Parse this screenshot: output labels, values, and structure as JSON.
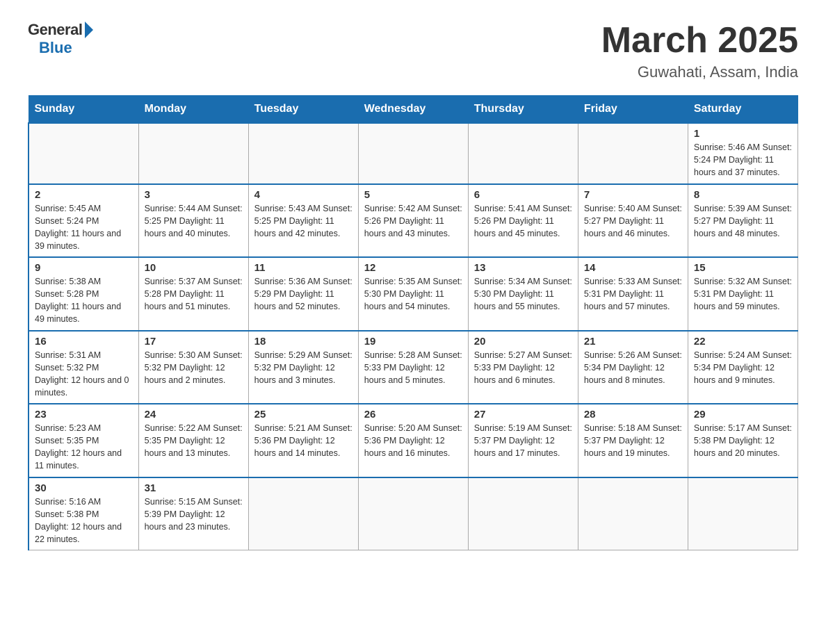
{
  "header": {
    "logo_general": "General",
    "logo_blue": "Blue",
    "title": "March 2025",
    "subtitle": "Guwahati, Assam, India"
  },
  "weekdays": [
    "Sunday",
    "Monday",
    "Tuesday",
    "Wednesday",
    "Thursday",
    "Friday",
    "Saturday"
  ],
  "weeks": [
    [
      {
        "day": "",
        "info": ""
      },
      {
        "day": "",
        "info": ""
      },
      {
        "day": "",
        "info": ""
      },
      {
        "day": "",
        "info": ""
      },
      {
        "day": "",
        "info": ""
      },
      {
        "day": "",
        "info": ""
      },
      {
        "day": "1",
        "info": "Sunrise: 5:46 AM\nSunset: 5:24 PM\nDaylight: 11 hours\nand 37 minutes."
      }
    ],
    [
      {
        "day": "2",
        "info": "Sunrise: 5:45 AM\nSunset: 5:24 PM\nDaylight: 11 hours\nand 39 minutes."
      },
      {
        "day": "3",
        "info": "Sunrise: 5:44 AM\nSunset: 5:25 PM\nDaylight: 11 hours\nand 40 minutes."
      },
      {
        "day": "4",
        "info": "Sunrise: 5:43 AM\nSunset: 5:25 PM\nDaylight: 11 hours\nand 42 minutes."
      },
      {
        "day": "5",
        "info": "Sunrise: 5:42 AM\nSunset: 5:26 PM\nDaylight: 11 hours\nand 43 minutes."
      },
      {
        "day": "6",
        "info": "Sunrise: 5:41 AM\nSunset: 5:26 PM\nDaylight: 11 hours\nand 45 minutes."
      },
      {
        "day": "7",
        "info": "Sunrise: 5:40 AM\nSunset: 5:27 PM\nDaylight: 11 hours\nand 46 minutes."
      },
      {
        "day": "8",
        "info": "Sunrise: 5:39 AM\nSunset: 5:27 PM\nDaylight: 11 hours\nand 48 minutes."
      }
    ],
    [
      {
        "day": "9",
        "info": "Sunrise: 5:38 AM\nSunset: 5:28 PM\nDaylight: 11 hours\nand 49 minutes."
      },
      {
        "day": "10",
        "info": "Sunrise: 5:37 AM\nSunset: 5:28 PM\nDaylight: 11 hours\nand 51 minutes."
      },
      {
        "day": "11",
        "info": "Sunrise: 5:36 AM\nSunset: 5:29 PM\nDaylight: 11 hours\nand 52 minutes."
      },
      {
        "day": "12",
        "info": "Sunrise: 5:35 AM\nSunset: 5:30 PM\nDaylight: 11 hours\nand 54 minutes."
      },
      {
        "day": "13",
        "info": "Sunrise: 5:34 AM\nSunset: 5:30 PM\nDaylight: 11 hours\nand 55 minutes."
      },
      {
        "day": "14",
        "info": "Sunrise: 5:33 AM\nSunset: 5:31 PM\nDaylight: 11 hours\nand 57 minutes."
      },
      {
        "day": "15",
        "info": "Sunrise: 5:32 AM\nSunset: 5:31 PM\nDaylight: 11 hours\nand 59 minutes."
      }
    ],
    [
      {
        "day": "16",
        "info": "Sunrise: 5:31 AM\nSunset: 5:32 PM\nDaylight: 12 hours\nand 0 minutes."
      },
      {
        "day": "17",
        "info": "Sunrise: 5:30 AM\nSunset: 5:32 PM\nDaylight: 12 hours\nand 2 minutes."
      },
      {
        "day": "18",
        "info": "Sunrise: 5:29 AM\nSunset: 5:32 PM\nDaylight: 12 hours\nand 3 minutes."
      },
      {
        "day": "19",
        "info": "Sunrise: 5:28 AM\nSunset: 5:33 PM\nDaylight: 12 hours\nand 5 minutes."
      },
      {
        "day": "20",
        "info": "Sunrise: 5:27 AM\nSunset: 5:33 PM\nDaylight: 12 hours\nand 6 minutes."
      },
      {
        "day": "21",
        "info": "Sunrise: 5:26 AM\nSunset: 5:34 PM\nDaylight: 12 hours\nand 8 minutes."
      },
      {
        "day": "22",
        "info": "Sunrise: 5:24 AM\nSunset: 5:34 PM\nDaylight: 12 hours\nand 9 minutes."
      }
    ],
    [
      {
        "day": "23",
        "info": "Sunrise: 5:23 AM\nSunset: 5:35 PM\nDaylight: 12 hours\nand 11 minutes."
      },
      {
        "day": "24",
        "info": "Sunrise: 5:22 AM\nSunset: 5:35 PM\nDaylight: 12 hours\nand 13 minutes."
      },
      {
        "day": "25",
        "info": "Sunrise: 5:21 AM\nSunset: 5:36 PM\nDaylight: 12 hours\nand 14 minutes."
      },
      {
        "day": "26",
        "info": "Sunrise: 5:20 AM\nSunset: 5:36 PM\nDaylight: 12 hours\nand 16 minutes."
      },
      {
        "day": "27",
        "info": "Sunrise: 5:19 AM\nSunset: 5:37 PM\nDaylight: 12 hours\nand 17 minutes."
      },
      {
        "day": "28",
        "info": "Sunrise: 5:18 AM\nSunset: 5:37 PM\nDaylight: 12 hours\nand 19 minutes."
      },
      {
        "day": "29",
        "info": "Sunrise: 5:17 AM\nSunset: 5:38 PM\nDaylight: 12 hours\nand 20 minutes."
      }
    ],
    [
      {
        "day": "30",
        "info": "Sunrise: 5:16 AM\nSunset: 5:38 PM\nDaylight: 12 hours\nand 22 minutes."
      },
      {
        "day": "31",
        "info": "Sunrise: 5:15 AM\nSunset: 5:39 PM\nDaylight: 12 hours\nand 23 minutes."
      },
      {
        "day": "",
        "info": ""
      },
      {
        "day": "",
        "info": ""
      },
      {
        "day": "",
        "info": ""
      },
      {
        "day": "",
        "info": ""
      },
      {
        "day": "",
        "info": ""
      }
    ]
  ]
}
